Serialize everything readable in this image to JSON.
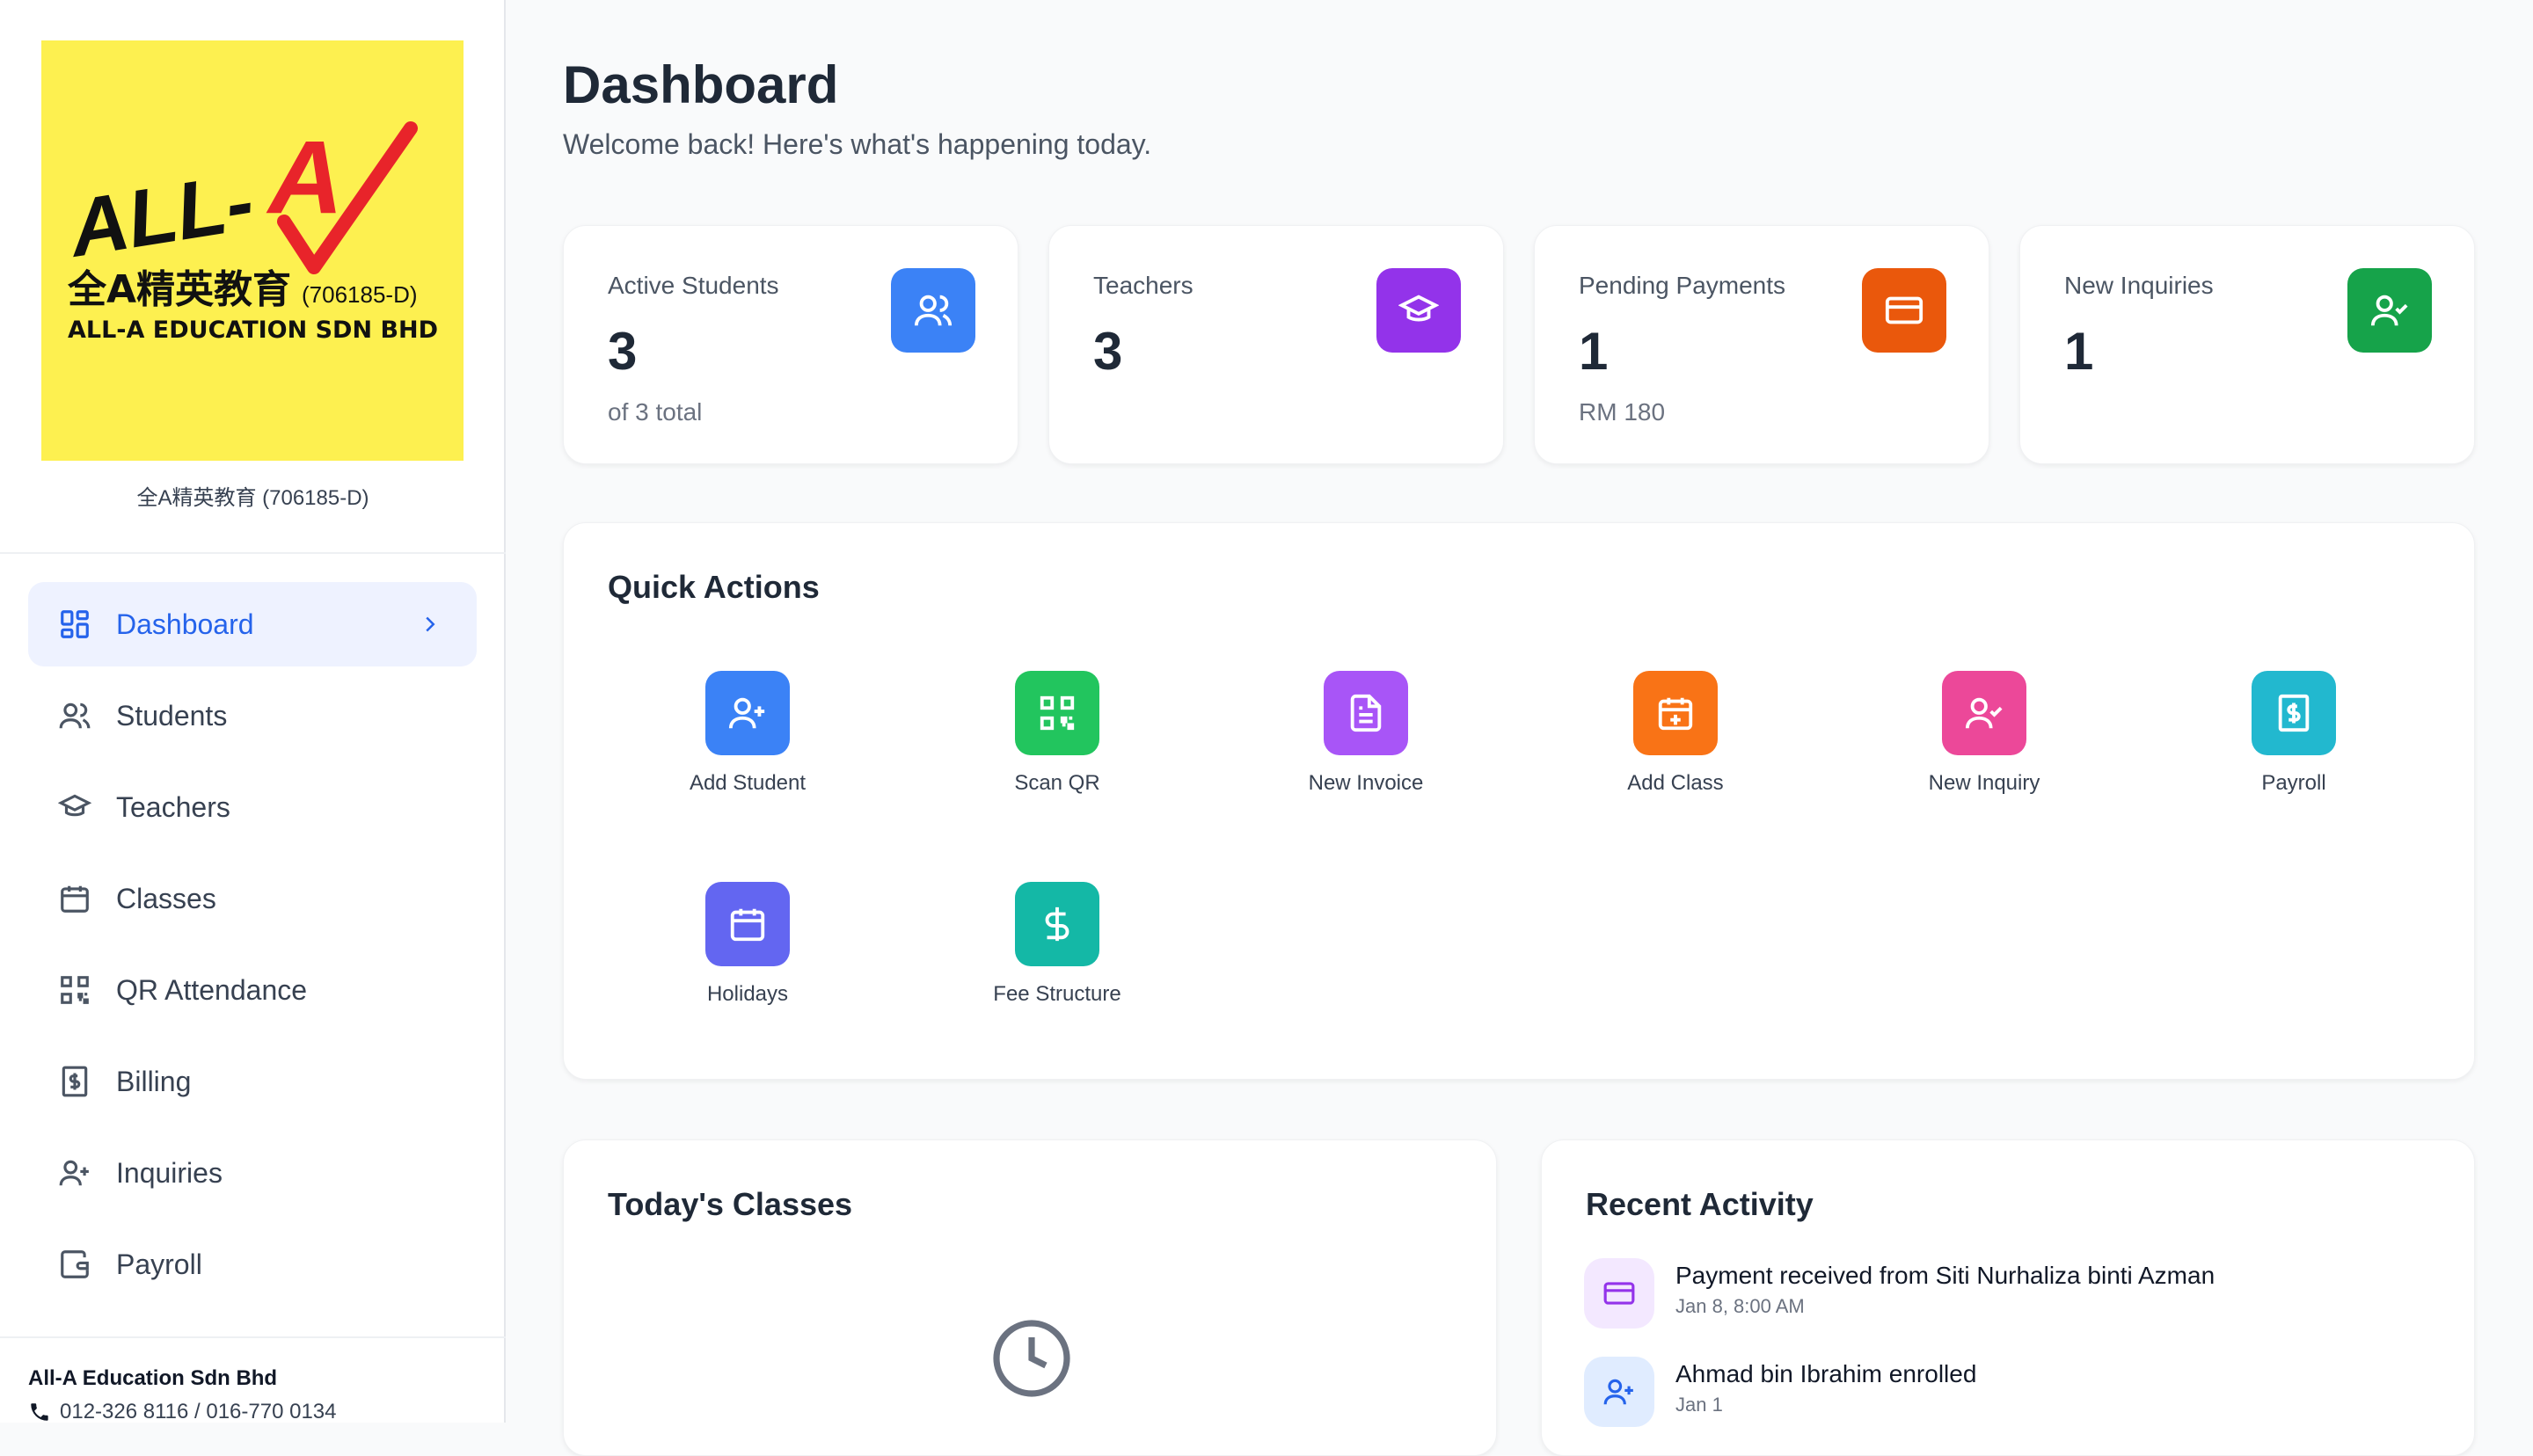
{
  "brand": {
    "logo_text_main": "ALL-",
    "logo_letter": "A",
    "logo_chinese": "全A精英教育",
    "logo_reg": "(706185-D)",
    "logo_company": "ALL-A EDUCATION SDN BHD",
    "caption": "全A精英教育 (706185-D)"
  },
  "sidebar": {
    "items": [
      {
        "label": "Dashboard",
        "icon": "layout-grid-icon"
      },
      {
        "label": "Students",
        "icon": "users-icon"
      },
      {
        "label": "Teachers",
        "icon": "graduation-cap-icon"
      },
      {
        "label": "Classes",
        "icon": "calendar-icon"
      },
      {
        "label": "QR Attendance",
        "icon": "qr-code-icon"
      },
      {
        "label": "Billing",
        "icon": "receipt-icon"
      },
      {
        "label": "Inquiries",
        "icon": "user-plus-icon"
      },
      {
        "label": "Payroll",
        "icon": "wallet-icon"
      }
    ],
    "company_name": "All-A Education Sdn Bhd",
    "company_phone": "012-326 8116 / 016-770 0134"
  },
  "header": {
    "title": "Dashboard",
    "subtitle": "Welcome back! Here's what's happening today."
  },
  "stats": [
    {
      "label": "Active Students",
      "value": "3",
      "sub": "of 3 total",
      "color": "#3b82f6"
    },
    {
      "label": "Teachers",
      "value": "3",
      "sub": "",
      "color": "#9333ea"
    },
    {
      "label": "Pending Payments",
      "value": "1",
      "sub": "RM 180",
      "color": "#ea580c"
    },
    {
      "label": "New Inquiries",
      "value": "1",
      "sub": "",
      "color": "#16a34a"
    }
  ],
  "quick_actions": {
    "title": "Quick Actions",
    "items": [
      {
        "label": "Add Student",
        "color": "#3b82f6"
      },
      {
        "label": "Scan QR",
        "color": "#22c55e"
      },
      {
        "label": "New Invoice",
        "color": "#a855f7"
      },
      {
        "label": "Add Class",
        "color": "#f97316"
      },
      {
        "label": "New Inquiry",
        "color": "#ec4899"
      },
      {
        "label": "Payroll",
        "color": "#06b6d4"
      },
      {
        "label": "Holidays",
        "color": "#6366f1"
      },
      {
        "label": "Fee Structure",
        "color": "#14b8a6"
      }
    ]
  },
  "todays_classes": {
    "title": "Today's Classes"
  },
  "recent_activity": {
    "title": "Recent Activity",
    "items": [
      {
        "title": "Payment received from Siti Nurhaliza binti Azman",
        "time": "Jan 8, 8:00 AM"
      },
      {
        "title": "Ahmad bin Ibrahim enrolled",
        "time": "Jan 1"
      }
    ]
  }
}
